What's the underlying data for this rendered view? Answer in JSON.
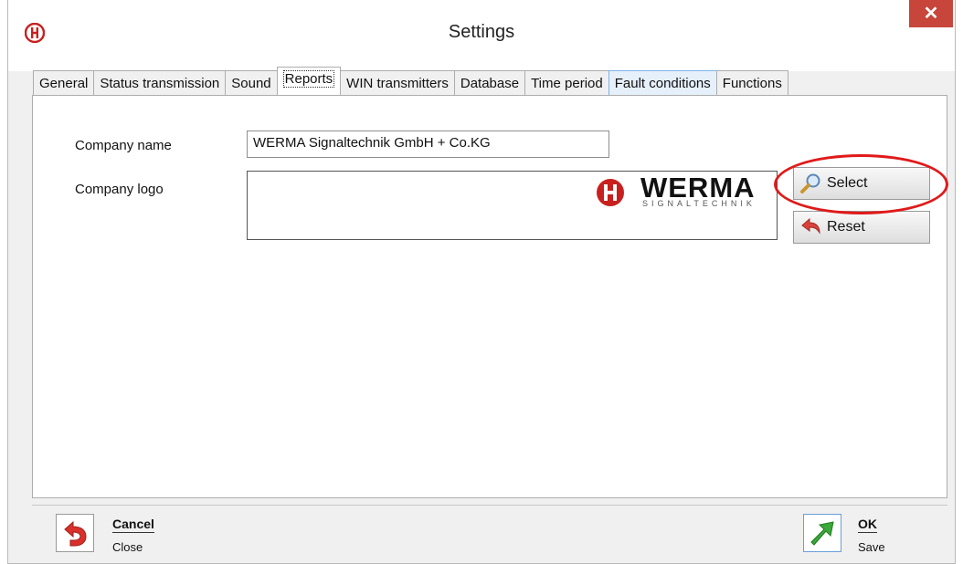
{
  "window": {
    "title": "Settings",
    "close_glyph": "✕"
  },
  "tabs": [
    {
      "label": "General",
      "active": false
    },
    {
      "label": "Status transmission",
      "active": false
    },
    {
      "label": "Sound",
      "active": false
    },
    {
      "label": "Reports",
      "active": true
    },
    {
      "label": "WIN transmitters",
      "active": false
    },
    {
      "label": "Database",
      "active": false
    },
    {
      "label": "Time period",
      "active": false
    },
    {
      "label": "Fault conditions",
      "active": false
    },
    {
      "label": "Functions",
      "active": false
    }
  ],
  "form": {
    "company_name_label": "Company name",
    "company_name_value": "WERMA Signaltechnik GmbH + Co.KG",
    "company_logo_label": "Company logo",
    "logo_word": "WERMA",
    "logo_sub": "SIGNALTECHNIK"
  },
  "buttons": {
    "select_label": "Select",
    "reset_label": "Reset"
  },
  "footer": {
    "cancel_title": "Cancel",
    "cancel_sub": "Close",
    "ok_title": "OK",
    "ok_sub": "Save"
  },
  "colors": {
    "accent_red": "#e01a1a",
    "close_button": "#c7453a",
    "ok_green": "#3aa83a",
    "cancel_red": "#d9302c"
  },
  "icons": [
    "werma-logo-icon",
    "close-icon",
    "magnifier-icon",
    "undo-arrow-icon",
    "cancel-icon",
    "ok-arrow-icon"
  ]
}
